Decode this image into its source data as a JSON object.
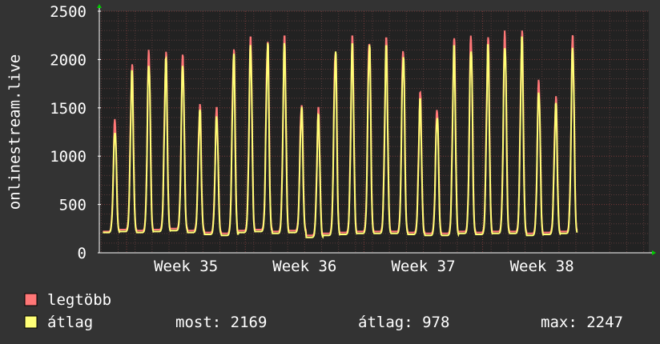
{
  "chart_data": {
    "type": "line",
    "ylabel": "onlinestream.live",
    "ylim": [
      0,
      2500
    ],
    "yticks": [
      0,
      500,
      1000,
      1500,
      2000,
      2500
    ],
    "x_range_weeks": [
      34.27,
      38.9
    ],
    "x_ticks": [
      {
        "label": "Week 35",
        "week": 35
      },
      {
        "label": "Week 36",
        "week": 36
      },
      {
        "label": "Week 37",
        "week": 37
      },
      {
        "label": "Week 38",
        "week": 38
      }
    ],
    "grid": true,
    "legend_position": "bottom-left",
    "series": [
      {
        "name": "legtöbb",
        "color": "#ff7777",
        "daily_peaks": [
          1390,
          1950,
          2100,
          2080,
          2050,
          1540,
          1500,
          2140,
          2230,
          2250,
          2240,
          1590,
          1500,
          2180,
          2240,
          2280,
          2220,
          2180,
          1660,
          1520,
          2220,
          2280,
          2230,
          2300,
          2300,
          1790,
          1620,
          2250
        ],
        "daily_troughs": [
          220,
          240,
          230,
          240,
          250,
          230,
          210,
          200,
          230,
          240,
          220,
          230,
          180,
          200,
          210,
          220,
          220,
          220,
          210,
          200,
          200,
          220,
          210,
          220,
          220,
          200,
          210,
          220
        ]
      },
      {
        "name": "átlag",
        "color": "#ffff77",
        "daily_peaks": [
          1300,
          1880,
          2020,
          2010,
          1990,
          1480,
          1430,
          2060,
          2150,
          2170,
          2170,
          1510,
          1430,
          2100,
          2160,
          2200,
          2140,
          2100,
          1590,
          1460,
          2140,
          2200,
          2150,
          2230,
          2230,
          1720,
          1550,
          2169
        ],
        "daily_troughs": [
          210,
          220,
          210,
          220,
          230,
          210,
          190,
          180,
          210,
          220,
          200,
          210,
          160,
          180,
          190,
          200,
          200,
          200,
          190,
          180,
          180,
          200,
          190,
          200,
          200,
          180,
          190,
          200
        ]
      }
    ]
  },
  "legend": {
    "items": [
      {
        "label": "legtöbb",
        "color": "#ff7777"
      },
      {
        "label": "átlag",
        "color": "#ffff77"
      }
    ],
    "stats": {
      "now_label": "most: 2169",
      "avg_label": "átlag: 978",
      "max_label": "max: 2247"
    }
  },
  "colors": {
    "background": "#333333",
    "plot_background": "#222222",
    "text": "#ffffff",
    "minor_grid": "#5a3a3a",
    "major_grid": "#7a3a3a",
    "arrow": "#00cc00"
  }
}
